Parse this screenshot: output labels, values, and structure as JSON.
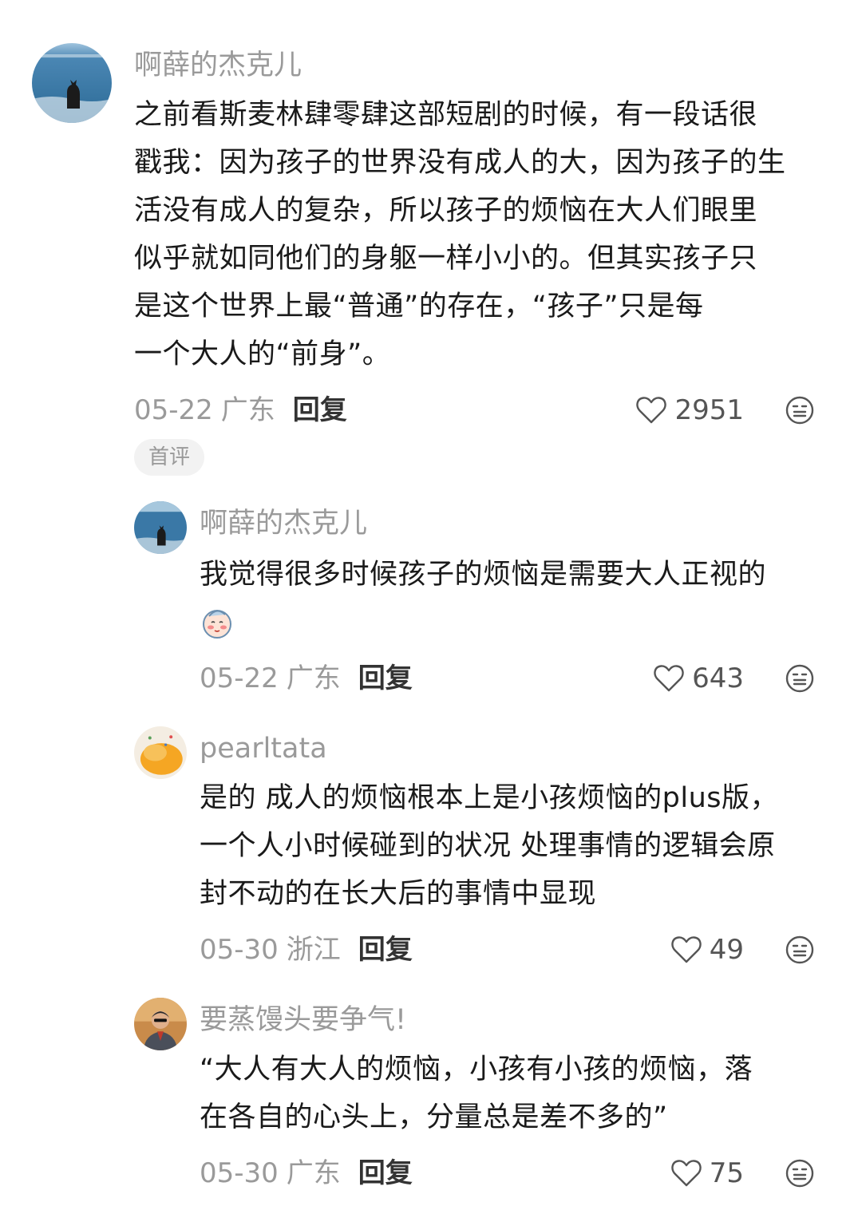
{
  "comments": [
    {
      "username": "啊薛的杰克儿",
      "text_lines": [
        "之前看斯麦林肆零肆这部短剧的时候，有一段话很",
        "戳我：因为孩子的世界没有成人的大，因为孩子的生",
        "活没有成人的复杂，所以孩子的烦恼在大人们眼里",
        "似乎就如同他们的身躯一样小小的。但其实孩子只",
        "是这个世界上最“普通”的存在，“孩子”只是每",
        "一个大人的“前身”。"
      ],
      "date": "05-22",
      "location": "广东",
      "reply_label": "回复",
      "likes": "2951",
      "badge": "首评",
      "avatar_icon": "ocean-cat-avatar"
    },
    {
      "username": "啊薛的杰克儿",
      "text_lines": [
        "我觉得很多时候孩子的烦恼是需要大人正视的"
      ],
      "emoji": "blushing-face-emoji",
      "date": "05-22",
      "location": "广东",
      "reply_label": "回复",
      "likes": "643",
      "avatar_icon": "ocean-cat-avatar"
    },
    {
      "username": "pearltata",
      "text_lines": [
        "是的 成人的烦恼根本上是小孩烦恼的plus版，",
        "一个人小时候碰到的状况 处理事情的逻辑会原",
        "封不动的在长大后的事情中显现"
      ],
      "date": "05-30",
      "location": "浙江",
      "reply_label": "回复",
      "likes": "49",
      "avatar_icon": "orange-painting-avatar"
    },
    {
      "username": "要蒸馒头要争气!",
      "text_lines": [
        "“大人有大人的烦恼，小孩有小孩的烦恼，落",
        "在各自的心头上，分量总是差不多的”"
      ],
      "date": "05-30",
      "location": "广东",
      "reply_label": "回复",
      "likes": "75",
      "avatar_icon": "man-in-suit-avatar"
    }
  ],
  "colors": {
    "meta_gray": "#9a9a9a",
    "text": "#1a1a1a",
    "badge_bg": "#f2f2f2"
  },
  "icons": {
    "like": "heart-outline-icon",
    "dislike": "neutral-face-icon"
  }
}
